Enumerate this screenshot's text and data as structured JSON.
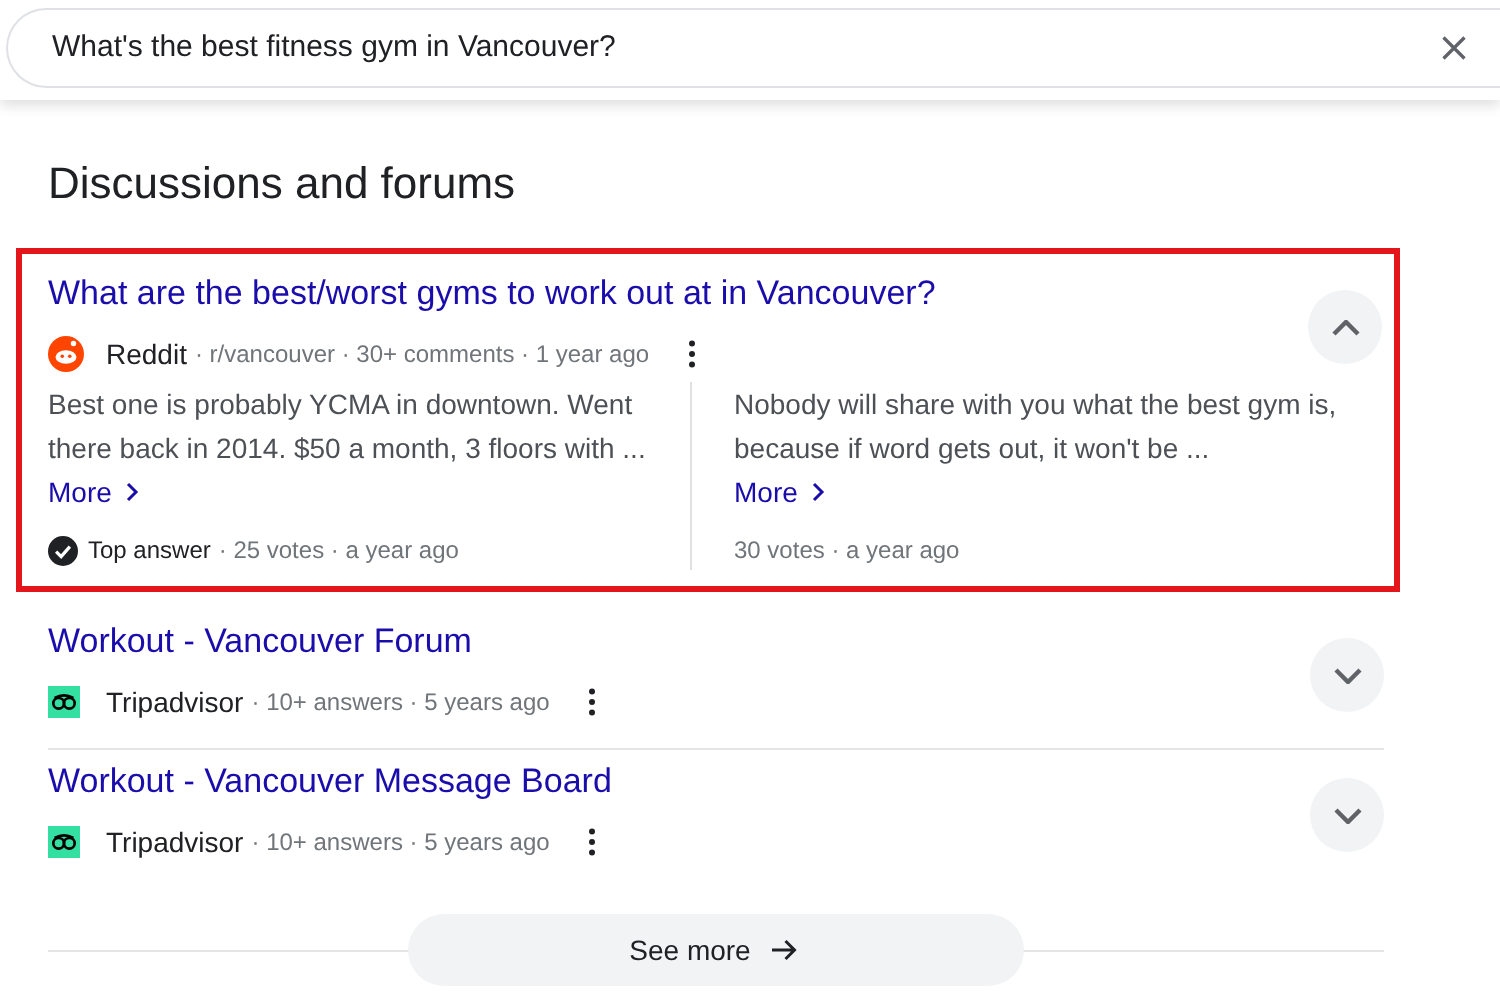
{
  "search": {
    "value": "What's the best fitness gym in Vancouver?"
  },
  "heading": "Discussions and forums",
  "results": [
    {
      "kind": "reddit",
      "highlighted": true,
      "expanded": true,
      "title": "What are the best/worst gyms to work out at in Vancouver?",
      "source": "Reddit",
      "details": "· r/vancouver · 30+ comments · 1 year ago",
      "answers": [
        {
          "text": "Best one is probably YCMA in downtown. Went there back in 2014. $50 a month, 3 floors with ...",
          "more": "More",
          "top_answer": true,
          "badge": "Top answer",
          "votes": "· 25 votes · a year ago"
        },
        {
          "text": "Nobody will share with you what the best gym is, because if word gets out, it won't be ...",
          "more": "More",
          "top_answer": false,
          "votes": "30 votes · a year ago"
        }
      ]
    },
    {
      "kind": "tripadvisor",
      "highlighted": false,
      "expanded": false,
      "title": "Workout - Vancouver Forum",
      "source": "Tripadvisor",
      "details": "· 10+ answers · 5 years ago"
    },
    {
      "kind": "tripadvisor",
      "highlighted": false,
      "expanded": false,
      "title": "Workout - Vancouver Message Board",
      "source": "Tripadvisor",
      "details": "· 10+ answers · 5 years ago"
    }
  ],
  "see_more": "See more"
}
